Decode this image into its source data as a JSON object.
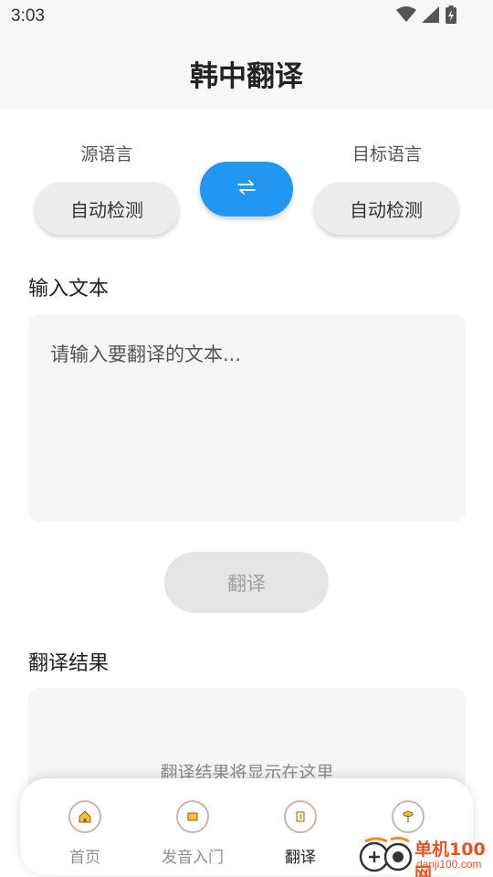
{
  "status_bar": {
    "time": "3:03",
    "icons": [
      "wifi-icon",
      "cell-signal-icon",
      "battery-charging-icon"
    ]
  },
  "header": {
    "title": "韩中翻译"
  },
  "languages": {
    "source_label": "源语言",
    "source_value": "自动检测",
    "target_label": "目标语言",
    "target_value": "自动检测",
    "swap_icon": "swap-arrows-icon",
    "swap_glyph": "⇄"
  },
  "input": {
    "label": "输入文本",
    "value": "",
    "placeholder": "请输入要翻译的文本..."
  },
  "translate_button": {
    "label": "翻译"
  },
  "output": {
    "label": "翻译结果",
    "placeholder": "翻译结果将显示在这里"
  },
  "bottom_nav": {
    "items": [
      {
        "label": "首页",
        "icon": "home-icon",
        "active": false
      },
      {
        "label": "发音入门",
        "icon": "book-icon",
        "active": false
      },
      {
        "label": "翻译",
        "icon": "translate-icon",
        "active": true
      },
      {
        "label": "",
        "icon": "pin-icon",
        "active": false
      }
    ]
  },
  "watermark": {
    "text_cn": "单机100网",
    "text_en": "danji100.com"
  },
  "colors": {
    "accent": "#2196f3",
    "button_bg": "#ededed",
    "disabled_bg": "#e5e5e5",
    "field_bg": "#f5f5f5",
    "header_bg": "#f7f7f7",
    "watermark": "#e0562a"
  }
}
